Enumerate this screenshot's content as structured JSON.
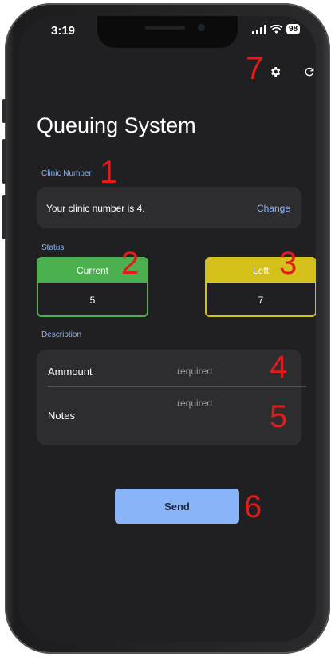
{
  "statusbar": {
    "time": "3:19",
    "battery": "98"
  },
  "toolbar": {
    "settings_icon": "gear-icon",
    "refresh_icon": "refresh-icon"
  },
  "title": "Queuing System",
  "clinic": {
    "section_label": "Clinic Number",
    "message": "Your clinic number is 4.",
    "change_label": "Change"
  },
  "status": {
    "section_label": "Status",
    "current": {
      "label": "Current",
      "value": "5",
      "color": "#4caf50"
    },
    "left": {
      "label": "Left",
      "value": "7",
      "color": "#d4c21a"
    }
  },
  "description": {
    "section_label": "Description",
    "amount_label": "Ammount",
    "amount_placeholder": "required",
    "notes_label": "Notes",
    "notes_placeholder": "required"
  },
  "send_label": "Send",
  "annotations": [
    "1",
    "2",
    "3",
    "4",
    "5",
    "6",
    "7"
  ],
  "colors": {
    "accent": "#8ab4f8",
    "background": "#202022",
    "annotation": "#e31b1b"
  }
}
